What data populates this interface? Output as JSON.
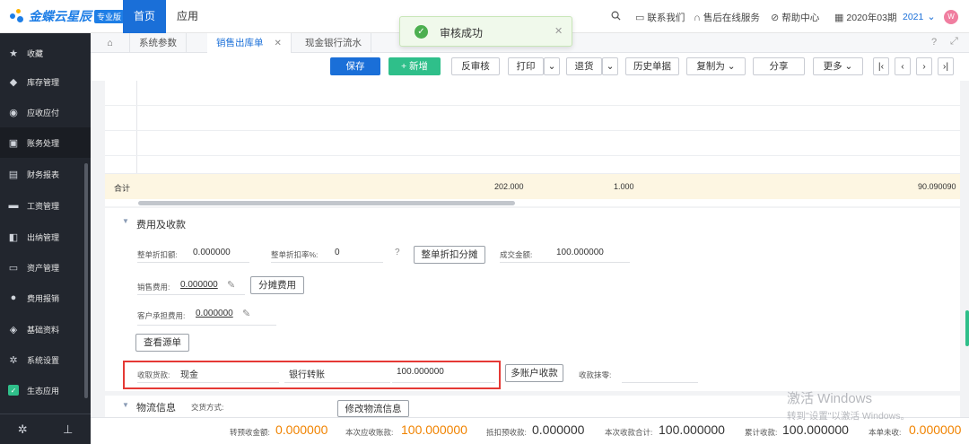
{
  "app": {
    "brand": "金蝶云星辰",
    "edition": "专业版"
  },
  "topnav": {
    "home": "首页",
    "apps": "应用"
  },
  "toplinks": {
    "search_icon": "search-icon",
    "contact": "联系我们",
    "after_sales": "售后在线服务",
    "help": "帮助中心",
    "period": "2020年03期",
    "year": "2021",
    "avatar_text": "W"
  },
  "sidebar": {
    "items": [
      {
        "label": "收藏",
        "icon": "star-icon"
      },
      {
        "label": "库存管理",
        "icon": "cube-icon"
      },
      {
        "label": "应收应付",
        "icon": "coin-icon"
      },
      {
        "label": "账务处理",
        "icon": "ledger-icon"
      },
      {
        "label": "财务报表",
        "icon": "report-icon"
      },
      {
        "label": "工资管理",
        "icon": "wallet-icon"
      },
      {
        "label": "出纳管理",
        "icon": "cashier-icon"
      },
      {
        "label": "资产管理",
        "icon": "asset-icon"
      },
      {
        "label": "费用报销",
        "icon": "expense-icon"
      },
      {
        "label": "基础资料",
        "icon": "layers-icon"
      },
      {
        "label": "系统设置",
        "icon": "gear-icon"
      },
      {
        "label": "生态应用",
        "icon": "check-icon"
      }
    ]
  },
  "tabs": [
    {
      "label": "系统参数"
    },
    {
      "label": "销售出库单"
    },
    {
      "label": "现金银行流水"
    }
  ],
  "toolbar": {
    "save": "保存",
    "add": "+ 新增",
    "unaudit": "反审核",
    "print": "打印",
    "return": "退货",
    "history": "历史单据",
    "copy_as": "复制为",
    "share": "分享",
    "more": "更多"
  },
  "grid": {
    "sum_label": "合计",
    "qty_total": "202.000",
    "unit_total": "1.000",
    "amount_total": "90.090090"
  },
  "fees": {
    "section_title": "费用及收款",
    "discount_amount_label": "整单折扣额:",
    "discount_amount_value": "0.000000",
    "discount_rate_label": "整单折扣率%:",
    "discount_rate_value": "0",
    "split_discount_btn": "整单折扣分摊",
    "deal_amount_label": "成交金额:",
    "deal_amount_value": "100.000000",
    "sales_fee_label": "销售费用:",
    "sales_fee_value": "0.000000",
    "split_fee_btn": "分摊费用",
    "customer_fee_label": "客户承担费用:",
    "customer_fee_value": "0.000000",
    "view_source_btn": "查看源单",
    "receive_label": "收取货款:",
    "receive_method": "现金",
    "bank_account": "银行转账",
    "receive_amount": "100.000000",
    "multi_account_btn": "多账户收款",
    "round_off_label": "收款抹零:"
  },
  "logistics": {
    "title": "物流信息",
    "delivery_label": "交货方式:",
    "edit_btn": "修改物流信息"
  },
  "footer": {
    "transfer_advance_label": "转预收金额:",
    "transfer_advance_value": "0.000000",
    "receivable_label": "本次应收账款:",
    "receivable_value": "100.000000",
    "deduct_advance_label": "抵扣预收款:",
    "deduct_advance_value": "0.000000",
    "this_receipt_label": "本次收款合计:",
    "this_receipt_value": "100.000000",
    "cumulative_label": "累计收款:",
    "cumulative_value": "100.000000",
    "unpaid_label": "本单未收:",
    "unpaid_value": "0.000000"
  },
  "toast": {
    "message": "审核成功"
  },
  "watermark": {
    "line1": "激活 Windows",
    "line2": "转到\"设置\"以激活 Windows。"
  },
  "colors": {
    "accent": "#1a6fd8",
    "success": "#4caf50",
    "amount": "#f08300",
    "highlight": "#e53935"
  }
}
